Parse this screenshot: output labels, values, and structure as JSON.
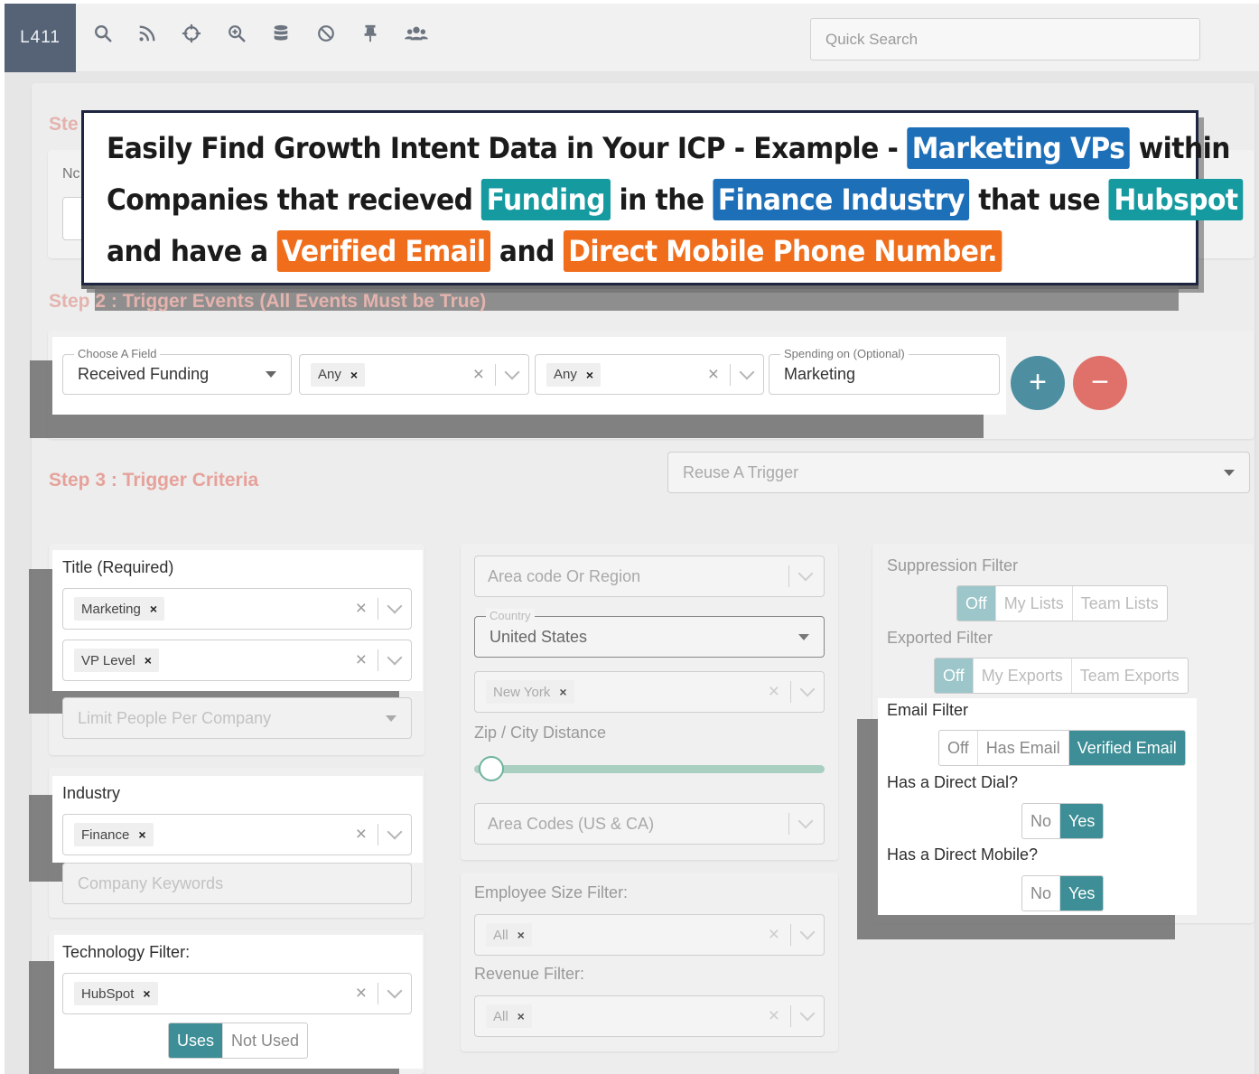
{
  "app": {
    "logo": "L411"
  },
  "toolbar": {
    "icons": [
      "search-icon",
      "rss-icon",
      "crosshair-icon",
      "zoom-in-icon",
      "database-icon",
      "ban-icon",
      "pin-icon",
      "users-icon"
    ],
    "quick_search_placeholder": "Quick Search"
  },
  "callout": {
    "line1_a": "Easily Find Growth Intent Data in Your ICP - Example -",
    "line1_hl": "Marketing VPs",
    "line1_b": "within",
    "line2_a": "Companies that recieved",
    "line2_hl1": "Funding",
    "line2_b": "in the",
    "line2_hl2": "Finance Industry",
    "line2_c": "that use",
    "line2_hl3": "Hubspot",
    "line3_a": "and have a",
    "line3_hl1": "Verified Email",
    "line3_b": "and",
    "line3_hl2": "Direct Mobile Phone Number."
  },
  "step1": {
    "label_fragment": "Ste",
    "sub_fragment": "Nc"
  },
  "step2": {
    "title": "Step 2 : Trigger Events (All Events Must be True)",
    "choose_field_legend": "Choose A Field",
    "choose_field_value": "Received Funding",
    "select1_chip": "Any",
    "select2_chip": "Any",
    "spending_legend": "Spending on (Optional)",
    "spending_value": "Marketing",
    "add_label": "+",
    "remove_label": "−"
  },
  "step3": {
    "title": "Step 3 : Trigger Criteria",
    "reuse_placeholder": "Reuse A Trigger"
  },
  "left": {
    "title_label": "Title (Required)",
    "title_chip1": "Marketing",
    "title_chip2": "VP Level",
    "limit_placeholder": "Limit People Per Company",
    "industry_label": "Industry",
    "industry_chip": "Finance",
    "keywords_placeholder": "Company Keywords",
    "tech_label": "Technology Filter:",
    "tech_chip": "HubSpot",
    "uses": "Uses",
    "not_used": "Not Used"
  },
  "middle": {
    "area_placeholder": "Area code Or Region",
    "country_legend": "Country",
    "country_value": "United States",
    "state_chip": "New York",
    "zip_label": "Zip / City Distance",
    "slider_value": 0.05,
    "area_codes_placeholder": "Area Codes (US & CA)",
    "employee_label": "Employee Size Filter:",
    "employee_chip": "All",
    "revenue_label": "Revenue Filter:",
    "revenue_chip": "All"
  },
  "right": {
    "suppression_label": "Suppression Filter",
    "suppression_opts": [
      "Off",
      "My Lists",
      "Team Lists"
    ],
    "exported_label": "Exported Filter",
    "exported_opts": [
      "Off",
      "My Exports",
      "Team Exports"
    ],
    "email_label": "Email Filter",
    "email_opts": [
      "Off",
      "Has Email",
      "Verified Email"
    ],
    "dial_label": "Has a Direct Dial?",
    "dial_opts": [
      "No",
      "Yes"
    ],
    "mobile_label": "Has a Direct Mobile?",
    "mobile_opts": [
      "No",
      "Yes"
    ]
  },
  "colors": {
    "accent": "#3d8e96",
    "add": "#4d8fa0",
    "remove": "#e0706a",
    "step": "#e6a29a"
  }
}
